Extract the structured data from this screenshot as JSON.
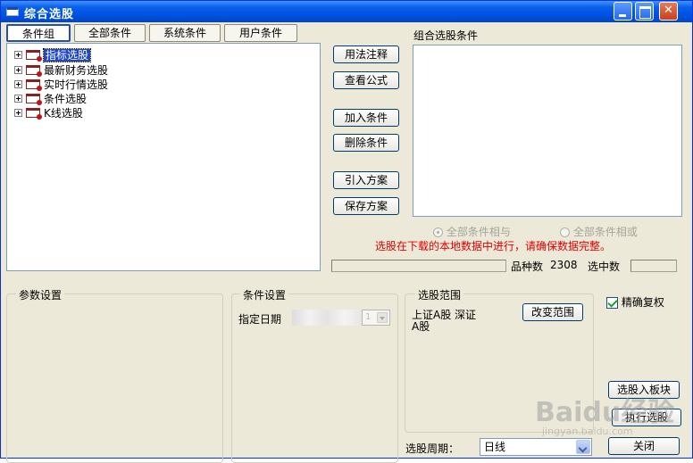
{
  "window": {
    "title": "综合选股"
  },
  "tabs": [
    "条件组",
    "全部条件",
    "系统条件",
    "用户条件"
  ],
  "tree": {
    "items": [
      {
        "label": "指标选股",
        "selected": true
      },
      {
        "label": "最新财务选股",
        "selected": false
      },
      {
        "label": "实时行情选股",
        "selected": false
      },
      {
        "label": "条件选股",
        "selected": false
      },
      {
        "label": "K线选股",
        "selected": false
      }
    ]
  },
  "actions": {
    "usage": "用法注释",
    "formula": "查看公式",
    "add": "加入条件",
    "delete": "删除条件",
    "import": "引入方案",
    "save": "保存方案"
  },
  "combo": {
    "title": "组合选股条件",
    "and_label": "全部条件相与",
    "or_label": "全部条件相或",
    "warning": "选股在下载的本地数据中进行，请确保数据完整。",
    "count_label": "品种数",
    "count_value": "2308",
    "selected_label": "选中数",
    "selected_value": ""
  },
  "params": {
    "title": "参数设置"
  },
  "condition_settings": {
    "title": "条件设置",
    "date_label": "指定日期",
    "spin_value": "1"
  },
  "range": {
    "title": "选股范围",
    "text_line1": "上证A股 深证",
    "text_line2": "A股",
    "change_button": "改变范围"
  },
  "options": {
    "exact_adjust": "精确复权",
    "exact_adjust_checked": true
  },
  "period": {
    "label": "选股周期：",
    "value": "日线"
  },
  "bottom_buttons": {
    "to_block": "选股入板块",
    "run": "执行选股",
    "close": "关闭"
  },
  "watermark": {
    "logo": "Baidu经验",
    "url": "jingyan.baidu.com"
  },
  "colors": {
    "title_blue": "#0054e3",
    "warning_red": "#e00000",
    "selection_blue": "#1e46c8"
  }
}
